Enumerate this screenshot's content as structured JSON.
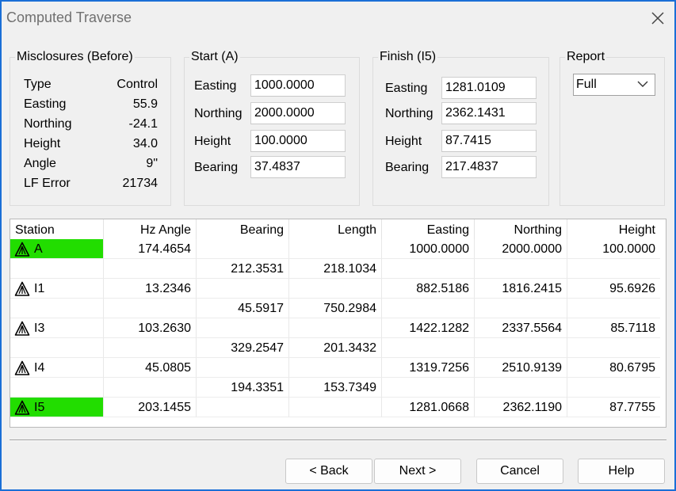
{
  "window": {
    "title": "Computed Traverse",
    "close_icon": "close-icon"
  },
  "misclosures": {
    "label": "Misclosures (Before)",
    "header": {
      "type": "Type",
      "control": "Control"
    },
    "rows": [
      {
        "label": "Easting",
        "value": "55.9"
      },
      {
        "label": "Northing",
        "value": "-24.1"
      },
      {
        "label": "Height",
        "value": "34.0"
      },
      {
        "label": "Angle",
        "value": "9\""
      },
      {
        "label": "LF Error",
        "value": "21734"
      }
    ]
  },
  "start": {
    "label": "Start (A)",
    "fields": [
      {
        "label": "Easting",
        "value": "1000.0000"
      },
      {
        "label": "Northing",
        "value": "2000.0000"
      },
      {
        "label": "Height",
        "value": "100.0000"
      },
      {
        "label": "Bearing",
        "value": "37.4837"
      }
    ]
  },
  "finish": {
    "label": "Finish (I5)",
    "fields": [
      {
        "label": "Easting",
        "value": "1281.0109"
      },
      {
        "label": "Northing",
        "value": "2362.1431"
      },
      {
        "label": "Height",
        "value": "87.7415"
      },
      {
        "label": "Bearing",
        "value": "217.4837"
      }
    ]
  },
  "report": {
    "label": "Report",
    "selected": "Full",
    "icon": "chevron-down-icon"
  },
  "table": {
    "columns": [
      "Station",
      "Hz Angle",
      "Bearing",
      "Length",
      "Easting",
      "Northing",
      "Height"
    ],
    "rows": [
      {
        "station": "A",
        "hz": "174.4654",
        "bearing": "",
        "length": "",
        "easting": "1000.0000",
        "northing": "2000.0000",
        "height": "100.0000",
        "highlight": true
      },
      {
        "station": "",
        "hz": "",
        "bearing": "212.3531",
        "length": "218.1034",
        "easting": "",
        "northing": "",
        "height": "",
        "highlight": false
      },
      {
        "station": "I1",
        "hz": "13.2346",
        "bearing": "",
        "length": "",
        "easting": "882.5186",
        "northing": "1816.2415",
        "height": "95.6926",
        "highlight": false
      },
      {
        "station": "",
        "hz": "",
        "bearing": "45.5917",
        "length": "750.2984",
        "easting": "",
        "northing": "",
        "height": "",
        "highlight": false
      },
      {
        "station": "I3",
        "hz": "103.2630",
        "bearing": "",
        "length": "",
        "easting": "1422.1282",
        "northing": "2337.5564",
        "height": "85.7118",
        "highlight": false
      },
      {
        "station": "",
        "hz": "",
        "bearing": "329.2547",
        "length": "201.3432",
        "easting": "",
        "northing": "",
        "height": "",
        "highlight": false
      },
      {
        "station": "I4",
        "hz": "45.0805",
        "bearing": "",
        "length": "",
        "easting": "1319.7256",
        "northing": "2510.9139",
        "height": "80.6795",
        "highlight": false
      },
      {
        "station": "",
        "hz": "",
        "bearing": "194.3351",
        "length": "153.7349",
        "easting": "",
        "northing": "",
        "height": "",
        "highlight": false
      },
      {
        "station": "I5",
        "hz": "203.1455",
        "bearing": "",
        "length": "",
        "easting": "1281.0668",
        "northing": "2362.1190",
        "height": "87.7755",
        "highlight": true
      }
    ],
    "station_icon": "tripod-warning-icon",
    "highlight_color": "#22dd00"
  },
  "buttons": {
    "back": "< Back",
    "next": "Next >",
    "cancel": "Cancel",
    "help": "Help"
  },
  "colors": {
    "window_border": "#1a6fd6",
    "background": "#f0f0f0"
  }
}
